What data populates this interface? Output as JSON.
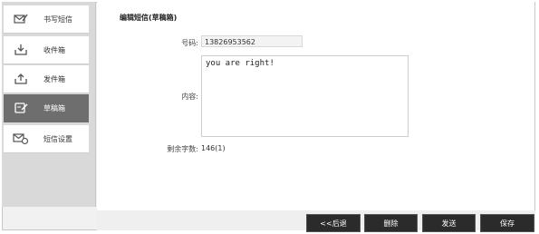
{
  "sidebar": {
    "items": [
      {
        "label": "书写短信",
        "icon": "compose-icon"
      },
      {
        "label": "收件箱",
        "icon": "inbox-icon"
      },
      {
        "label": "发件箱",
        "icon": "outbox-icon"
      },
      {
        "label": "草稿箱",
        "icon": "drafts-icon",
        "active": true
      },
      {
        "label": "短信设置",
        "icon": "sms-settings-icon"
      }
    ]
  },
  "form": {
    "title": "编辑短信(草稿箱)",
    "number_label": "号码:",
    "number_value": "13826953562",
    "content_label": "内容:",
    "content_value": "you are right!",
    "remaining_label": "剩余字数:",
    "remaining_value": "146(1)"
  },
  "buttons": {
    "back": "<<后退",
    "delete": "删除",
    "send": "发送",
    "save": "保存"
  }
}
